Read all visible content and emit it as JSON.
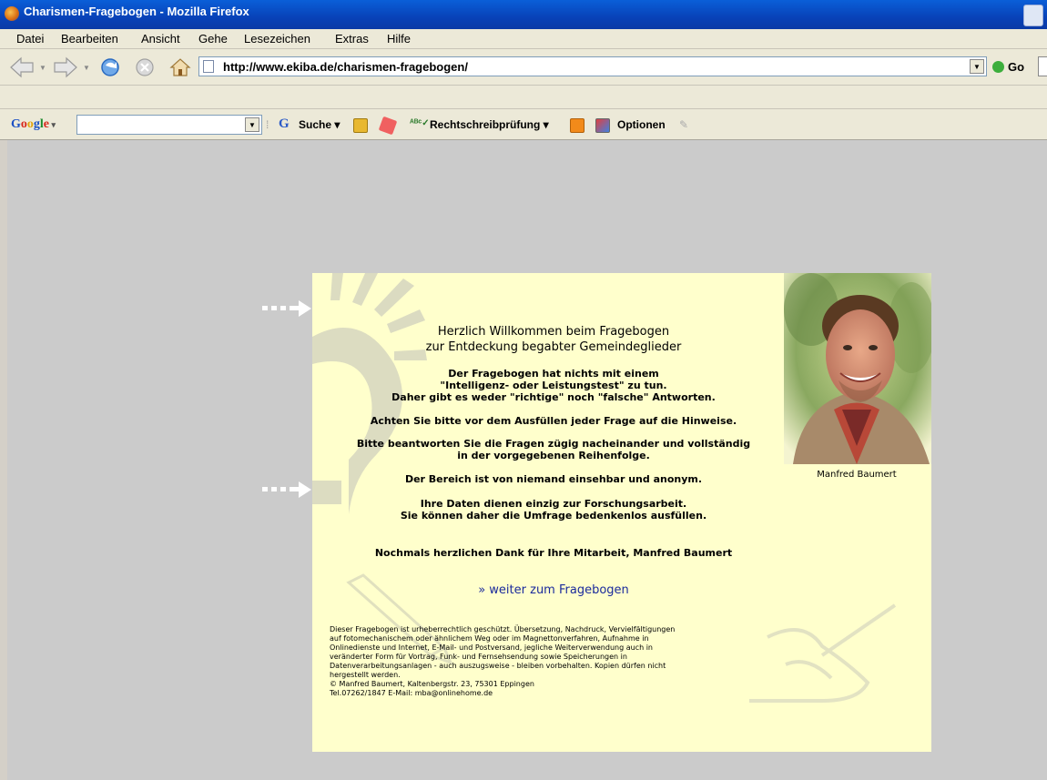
{
  "window": {
    "title": "Charismen-Fragebogen - Mozilla Firefox"
  },
  "menu": {
    "items": [
      "Datei",
      "Bearbeiten",
      "Ansicht",
      "Gehe",
      "Lesezeichen",
      "Extras",
      "Hilfe"
    ]
  },
  "nav": {
    "url": "http://www.ekiba.de/charismen-fragebogen/",
    "go_label": "Go"
  },
  "google_toolbar": {
    "logo": "Google",
    "search_value": "",
    "search_label": "Suche",
    "spellcheck_label": "Rechtschreibprüfung",
    "options_label": "Optionen"
  },
  "page": {
    "heading": [
      "Herzlich Willkommen beim Fragebogen",
      "zur Entdeckung begabter Gemeindeglieder"
    ],
    "para1": [
      "Der Fragebogen hat nichts mit einem",
      "\"Intelligenz- oder Leistungstest\" zu tun.",
      "Daher gibt es weder \"richtige\" noch \"falsche\" Antworten."
    ],
    "para2": "Achten Sie bitte vor dem Ausfüllen jeder Frage auf die Hinweise.",
    "para3": [
      "Bitte beantworten Sie die Fragen zügig nacheinander und vollständig",
      "in der vorgegebenen Reihenfolge."
    ],
    "para4": "Der Bereich ist von niemand einsehbar und anonym.",
    "para5": [
      "Ihre Daten dienen einzig zur Forschungsarbeit.",
      "Sie können daher die Umfrage bedenkenlos ausfüllen."
    ],
    "thanks": "Nochmals herzlichen Dank für Ihre Mitarbeit, Manfred Baumert",
    "link_label": "» weiter zum Fragebogen",
    "photo_caption": "Manfred Baumert",
    "copyright": [
      "Dieser Fragebogen ist urheberrechtlich geschützt. Übersetzung, Nachdruck, Vervielfältigungen",
      "auf fotomechanischem oder ähnlichem Weg oder im Magnettonverfahren, Aufnahme in",
      "Onlinedienste und Internet, E-Mail- und Postversand, jegliche Weiterverwendung auch in",
      "veränderter Form für Vortrag, Funk- und Fernsehsendung sowie Speicherungen in",
      "Datenverarbeitungsanlagen - auch auszugsweise - bleiben vorbehalten. Kopien dürfen nicht",
      "hergestellt werden.",
      "© Manfred Baumert, Kaltenbergstr. 23, 75301 Eppingen",
      "Tel.07262/1847  E-Mail: mba@onlinehome.de"
    ]
  },
  "colors": {
    "titlebar": "#0842b8",
    "chrome": "#ece9d8",
    "panel": "#ffffcc",
    "link": "#1a2a9c",
    "content_bg": "#cbcbcb"
  }
}
